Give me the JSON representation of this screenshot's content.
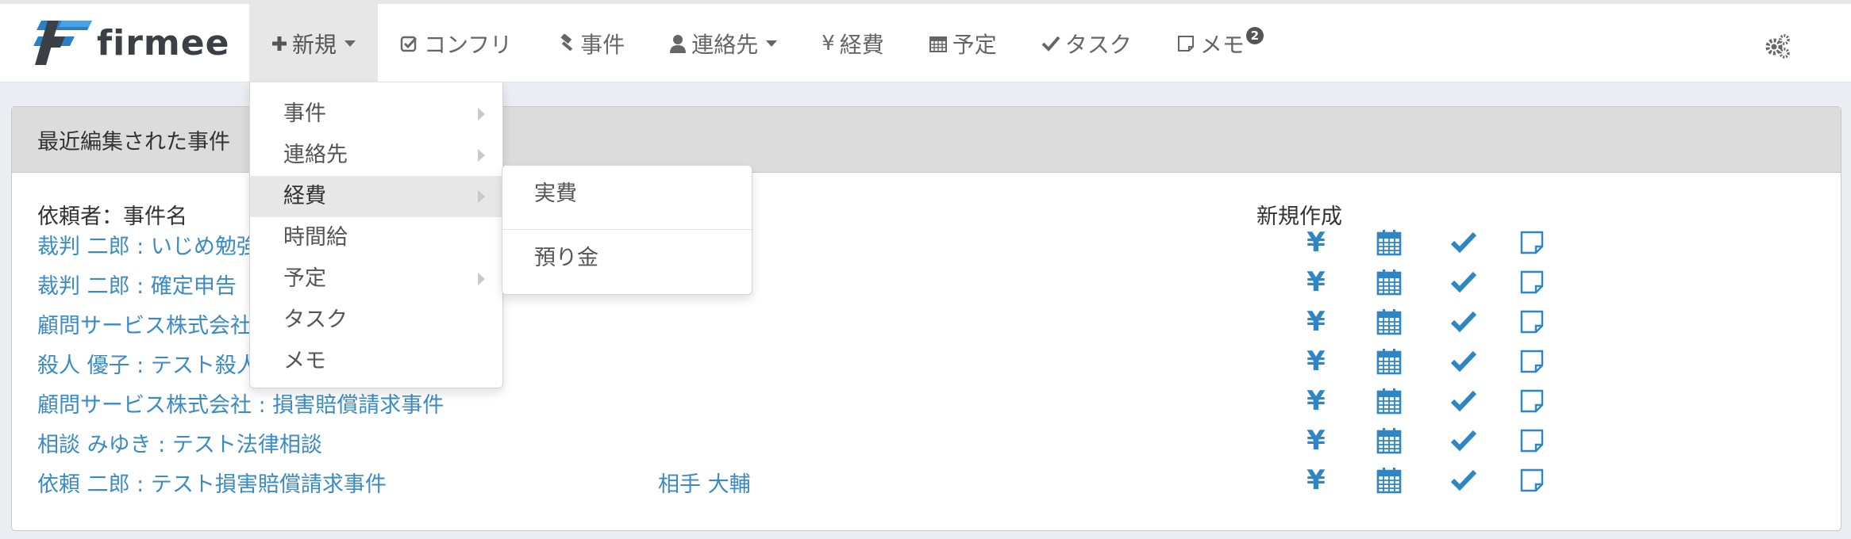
{
  "brand": {
    "name": "firmee"
  },
  "nav": {
    "new_label": "新規",
    "conflict_label": "コンフリ",
    "case_label": "事件",
    "contacts_label": "連絡先",
    "expense_label": "経費",
    "expense_symbol": "¥",
    "schedule_label": "予定",
    "task_label": "タスク",
    "memo_label": "メモ",
    "memo_badge": "2"
  },
  "new_menu": {
    "items": [
      "事件",
      "連絡先",
      "経費",
      "時間給",
      "予定",
      "タスク",
      "メモ"
    ],
    "active": "経費"
  },
  "expense_submenu": {
    "items": [
      "実費",
      "預り金"
    ]
  },
  "panel": {
    "title": "最近編集された事件",
    "col_case": "依頼者：事件名",
    "col_new": "新規作成"
  },
  "recent_cases": [
    {
      "case": "裁判 二郎 : いじめ勉強",
      "opponent": ""
    },
    {
      "case": "裁判 二郎 : 確定申告",
      "opponent": ""
    },
    {
      "case": "顧問サービス株式会社",
      "opponent": ""
    },
    {
      "case": "殺人 優子 : テスト殺人",
      "opponent": ""
    },
    {
      "case": "顧問サービス株式会社 : 損害賠償請求事件",
      "opponent": ""
    },
    {
      "case": "相談 みゆき : テスト法律相談",
      "opponent": ""
    },
    {
      "case": "依頼 二郎 : テスト損害賠償請求事件",
      "opponent": "相手 大輔"
    }
  ],
  "row_actions": {
    "expense_symbol": "¥",
    "icons": [
      "yen-icon",
      "calendar-icon",
      "check-icon",
      "memo-icon"
    ]
  },
  "colors": {
    "link": "#3b8bc5",
    "icon_blue": "#2f86c4",
    "panel_heading": "#dcdcdc",
    "page_bg": "#eaedf2"
  }
}
